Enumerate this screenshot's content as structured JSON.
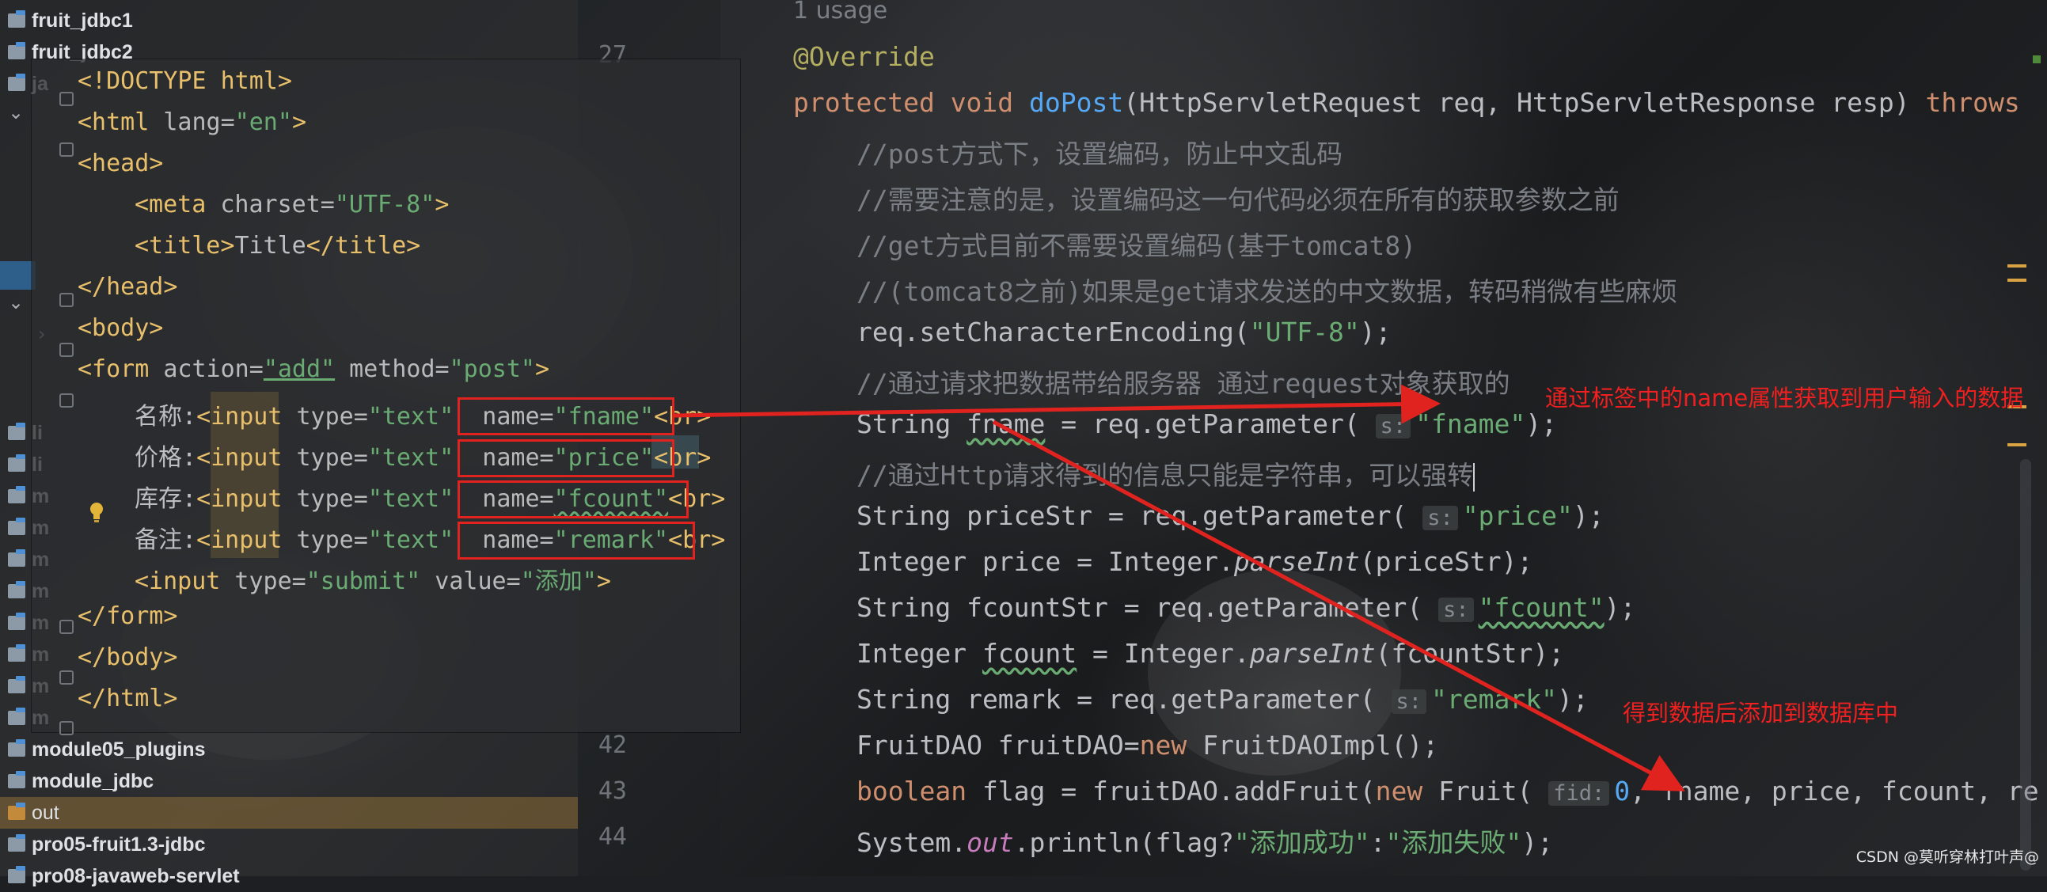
{
  "project_tree": {
    "items": [
      {
        "label": "fruit_jdbc1",
        "icon": "module-folder-icon"
      },
      {
        "label": "fruit_jdbc2",
        "icon": "module-folder-icon"
      },
      {
        "label": "ja",
        "icon": "module-folder-icon"
      },
      {
        "label": "li",
        "icon": "module-folder-icon"
      },
      {
        "label": "li",
        "icon": "module-folder-icon"
      },
      {
        "label": "m",
        "icon": "module-folder-icon"
      },
      {
        "label": "m",
        "icon": "module-folder-icon"
      },
      {
        "label": "m",
        "icon": "module-folder-icon"
      },
      {
        "label": "m",
        "icon": "module-folder-icon"
      },
      {
        "label": "m",
        "icon": "module-folder-icon"
      },
      {
        "label": "m",
        "icon": "module-folder-icon"
      },
      {
        "label": "m",
        "icon": "module-folder-icon"
      },
      {
        "label": "m",
        "icon": "module-folder-icon"
      },
      {
        "label": "module05_plugins",
        "icon": "module-folder-icon"
      },
      {
        "label": "module_jdbc",
        "icon": "module-folder-icon"
      },
      {
        "label": "out",
        "icon": "excluded-folder-icon"
      },
      {
        "label": "pro05-fruit1.3-jdbc",
        "icon": "module-folder-icon"
      },
      {
        "label": "pro08-javaweb-servlet",
        "icon": "module-folder-icon"
      }
    ]
  },
  "editor": {
    "line_numbers": [
      "27",
      "42",
      "43",
      "44"
    ],
    "usage_hint": "1 usage",
    "lines": {
      "annotation": "@Override",
      "kw_protected": "protected",
      "kw_void": "void",
      "method_name": "doPost",
      "signature": "(HttpServletRequest req, HttpServletResponse resp)",
      "kw_throws": "throws",
      "c1": "//post方式下，设置编码，防止中文乱码",
      "c2": "//需要注意的是，设置编码这一句代码必须在所有的获取参数之前",
      "c3": "//get方式目前不需要设置编码(基于tomcat8)",
      "c4": "//(tomcat8之前)如果是get请求发送的中文数据，转码稍微有些麻烦",
      "l5a": "req.setCharacterEncoding(",
      "l5s": "\"UTF-8\"",
      "l5b": ");",
      "c6": "//通过请求把数据带给服务器 通过request对象获取的",
      "l7a": "String ",
      "l7v": "fname",
      "l7b": " = req.getParameter(",
      "l7s": "\"fname\"",
      "l7c": ");",
      "c8": "//通过Http请求得到的信息只能是字符串，可以强转",
      "l9a": "String priceStr = req.getParameter(",
      "l9s": "\"price\"",
      "l9b": ");",
      "l10a": "Integer price = Integer.",
      "l10m": "parseInt",
      "l10b": "(priceStr);",
      "l11a": "String ",
      "l11v": "fcountStr",
      "l11b": " = req.getParameter(",
      "l11s": "\"fcount\"",
      "l11c": ");",
      "l12a": "Integer ",
      "l12v": "fcount",
      "l12b": " = Integer.",
      "l12m": "parseInt",
      "l12c": "(fcountStr);",
      "l13a": "String remark = req.getParameter(",
      "l13s": "\"remark\"",
      "l13b": ");",
      "l14a": "FruitDAO fruitDAO=",
      "l14k": "new",
      "l14b": " FruitDAOImpl();",
      "l15k": "boolean",
      "l15a": " flag = fruitDAO.addFruit(",
      "l15k2": "new",
      "l15b": " Fruit(",
      "l15n": "0",
      "l15c": ", fname, price, fcount, re",
      "l16a": "System.",
      "l16p": "out",
      "l16b": ".println(flag?",
      "l16s1": "\"添加成功\"",
      "l16c": ":",
      "l16s2": "\"添加失败\"",
      "l16d": ");"
    },
    "hints": {
      "s": "s:",
      "fid": "fid:"
    }
  },
  "html_popup": {
    "doctype": "<!DOCTYPE html>",
    "html_open_tag": "<html",
    "html_lang_attr": " lang=",
    "html_lang_val": "\"en\"",
    "gt": ">",
    "head_open": "<head>",
    "meta_tag": "<meta",
    "meta_attr": " charset=",
    "meta_val": "\"UTF-8\"",
    "title_open": "<title>",
    "title_text": "Title",
    "title_close": "</title>",
    "head_close": "</head>",
    "body_open": "<body>",
    "form_tag": "<form",
    "form_action_attr": " action=",
    "form_action_val": "\"add\"",
    "form_method_attr": " method=",
    "form_method_val": "\"post\"",
    "field_prefix_1": "名称:",
    "field_prefix_2": "价格:",
    "field_prefix_3": "库存:",
    "field_prefix_4": "备注:",
    "input_tag": "<input",
    "type_attr": " type=",
    "type_text": "\"text\"",
    "name_attr": " name=",
    "name_fname": "\"fname\"",
    "name_price": "\"price\"",
    "name_fcount": "\"fcount\"",
    "name_remark": "\"remark\"",
    "br_tag": "<br>",
    "submit_line_tag": "<input",
    "submit_type_val": "\"submit\"",
    "value_attr": " value=",
    "submit_value": "\"添加\"",
    "form_close": "</form>",
    "body_close": "</body>",
    "html_close": "</html>"
  },
  "annotations": {
    "arrow1_label": "通过标签中的name属性获取到用户输入的数据",
    "arrow2_label": "得到数据后添加到数据库中"
  },
  "watermark": "CSDN @莫听穿林打叶声@",
  "colors": {
    "annotation_red": "#e0231f",
    "keyword": "#cf8e6d",
    "string": "#6aab73",
    "comment": "#7a7e85",
    "tag": "#e8bf6a"
  }
}
